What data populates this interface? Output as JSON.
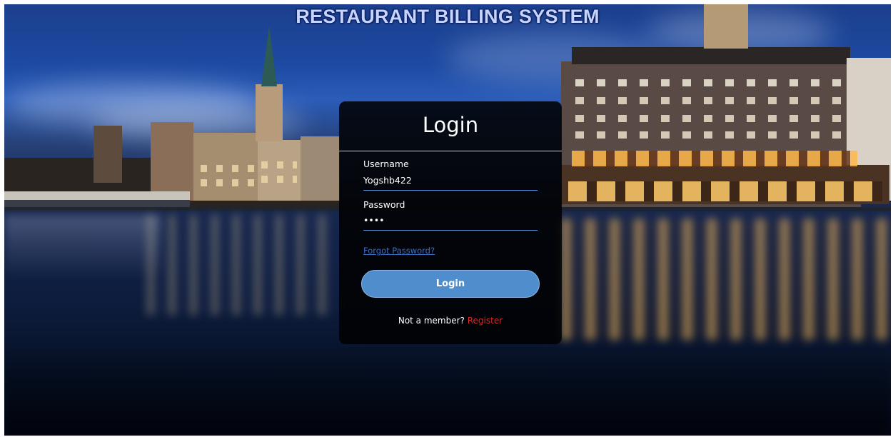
{
  "header": {
    "title": "RESTAURANT BILLING SYSTEM"
  },
  "login_form": {
    "title": "Login",
    "username": {
      "label": "Username",
      "value": "Yogshb422"
    },
    "password": {
      "label": "Password",
      "value": "••••"
    },
    "forgot_password_label": "Forgot Password?",
    "login_button_label": "Login",
    "register_prompt": "Not a member?",
    "register_link_label": "Register"
  },
  "colors": {
    "accent": "#4f8dcc",
    "link": "#3d6ec0",
    "register": "#d42b2b",
    "card_background": "#000000"
  }
}
